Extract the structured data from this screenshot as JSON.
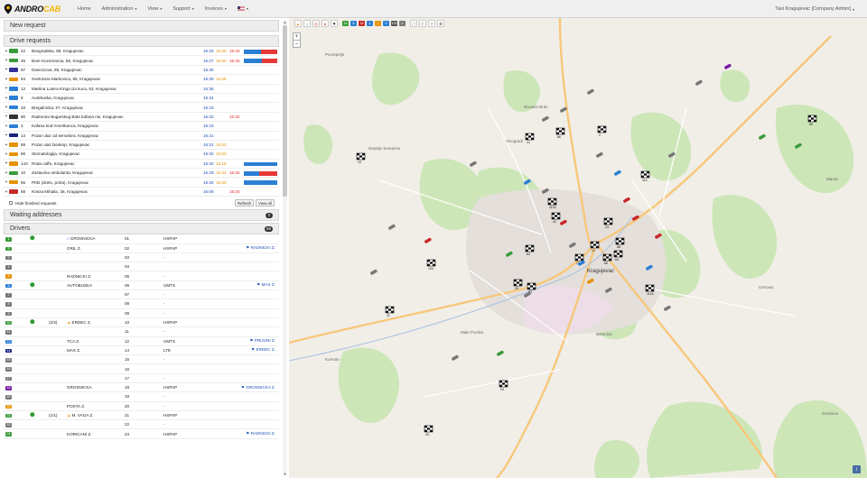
{
  "app": {
    "logo_part1": "ANDRO",
    "logo_part2": "CAB",
    "user": "Taxi Kragujevac [Company Admin]"
  },
  "nav": [
    {
      "label": "Home",
      "caret": false
    },
    {
      "label": "Administration",
      "caret": true
    },
    {
      "label": "View",
      "caret": true
    },
    {
      "label": "Support",
      "caret": true
    },
    {
      "label": "Invoices",
      "caret": true
    }
  ],
  "sections": {
    "new_request": "New request",
    "drive_requests": "Drive requests",
    "waiting_addresses": "Waiting addresses",
    "waiting_count": "0",
    "drivers": "Drivers",
    "drivers_count": "86"
  },
  "requests": [
    {
      "badge_color": "#3a9a3a",
      "num": "42",
      "addr": "Beogradska, 96, Kragujevac",
      "t1": "16:25",
      "t2": "16:30",
      "t3": "16:36",
      "bar": [
        0.5,
        0.5
      ]
    },
    {
      "badge_color": "#3a9a3a",
      "num": "45",
      "addr": "Bore Kozomarcia, 58, Kragujevac",
      "t1": "16:27",
      "t2": "16:30",
      "t3": "16:36",
      "bar": [
        0.55,
        0.45
      ]
    },
    {
      "badge_color": "#333399",
      "num": "87",
      "addr": "Danicicova, 85, Kragujevac",
      "t1": "16:35",
      "t2": "",
      "t3": "",
      "bar": null
    },
    {
      "badge_color": "#e69100",
      "num": "64",
      "addr": "Svetozara Markovica, 85, Kragujevac",
      "t1": "16:28",
      "t2": "16:35",
      "t3": "",
      "bar": null
    },
    {
      "badge_color": "#2a7fd4",
      "num": "12",
      "addr": "Martina Lutera Kinga iza kuca, 53, Kragujevac",
      "t1": "16:36",
      "t2": "",
      "t3": "",
      "bar": null
    },
    {
      "badge_color": "#2a7fd4",
      "num": "8",
      "addr": "Autobuska, Kragujevac",
      "t1": "16:34",
      "t2": "",
      "t3": "",
      "bar": null
    },
    {
      "badge_color": "#2a7fd4",
      "num": "33",
      "addr": "Bregalnicka, 57, Kragujevac",
      "t1": "16:33",
      "t2": "",
      "t3": "",
      "bar": null
    },
    {
      "badge_color": "#333",
      "num": "80",
      "addr": "Radomira Bugarskog Bate kafana nis, Kragujevac",
      "t1": "16:32",
      "t2": "",
      "t3": "16:32",
      "bar": null
    },
    {
      "badge_color": "#2a7fd4",
      "num": "2",
      "addr": "Kafana kod Amerikanca, Kragujevac",
      "t1": "16:33",
      "t2": "",
      "t3": "",
      "bar": null
    },
    {
      "badge_color": "#1a237e",
      "num": "14",
      "addr": "Pozar ulaz od semafora, Kragujevac",
      "t1": "16:31",
      "t2": "",
      "t3": "",
      "bar": null
    },
    {
      "badge_color": "#e69100",
      "num": "69",
      "addr": "Pozar ulaz bioskop, Kragujevac",
      "t1": "16:31",
      "t2": "16:33",
      "t3": "",
      "bar": null
    },
    {
      "badge_color": "#e69100",
      "num": "86",
      "addr": "Stomatologija, Kragujevac",
      "t1": "16:30",
      "t2": "16:33",
      "t3": "",
      "bar": null
    },
    {
      "badge_color": "#e69100",
      "num": "143",
      "addr": "Roda caffe, Kragujevac",
      "t1": "16:30",
      "t2": "16:18",
      "t3": "",
      "bar": [
        1.0,
        0.0
      ]
    },
    {
      "badge_color": "#3a9a3a",
      "num": "10",
      "addr": "Zastavina ambulanta, Kragujevac",
      "t1": "16:29",
      "t2": "16:32",
      "t3": "16:35",
      "bar": [
        0.45,
        0.55
      ]
    },
    {
      "badge_color": "#e69100",
      "num": "65",
      "addr": "PKB (dzelo, porta), Kragujevac",
      "t1": "16:28",
      "t2": "16:30",
      "t3": "",
      "bar": [
        1.0,
        0.0
      ]
    },
    {
      "badge_color": "#c62828",
      "num": "88",
      "addr": "Kneza Mihaila, 38, Kragujevac",
      "t1": "16:08",
      "t2": "",
      "t3": "16:26",
      "bar": null
    }
  ],
  "req_footer": {
    "hide_label": "Hide finished requests",
    "refresh": "Refresh",
    "view_all": "View all"
  },
  "drivers": [
    {
      "nb": "1",
      "color": "#3a9a3a",
      "pin": true,
      "note": "",
      "loc": "GROSNICKA",
      "loc_icon": "house",
      "vn": "01",
      "net": "HSPAP",
      "dest": ""
    },
    {
      "nb": "2",
      "color": "#3a9a3a",
      "pin": false,
      "note": "",
      "loc": "GRIL Z.",
      "loc_icon": "",
      "vn": "02",
      "net": "HSPAP",
      "dest": "RADNICKI Z."
    },
    {
      "nb": "3",
      "color": "#777",
      "pin": false,
      "note": "",
      "loc": "",
      "loc_icon": "",
      "vn": "03",
      "net": "-",
      "dest": ""
    },
    {
      "nb": "4",
      "color": "#777",
      "pin": false,
      "note": "",
      "loc": "",
      "loc_icon": "",
      "vn": "04",
      "net": "",
      "dest": ""
    },
    {
      "nb": "5",
      "color": "#e69100",
      "pin": false,
      "note": "",
      "loc": "RADNICKI Z.",
      "loc_icon": "",
      "vn": "05",
      "net": "-",
      "dest": ""
    },
    {
      "nb": "6",
      "color": "#2a7fd4",
      "pin": true,
      "note": "",
      "loc": "AUTOBUSKA",
      "loc_icon": "",
      "vn": "06",
      "net": "UMTS",
      "dest": "MAX Z."
    },
    {
      "nb": "7",
      "color": "#777",
      "pin": false,
      "note": "",
      "loc": "",
      "loc_icon": "",
      "vn": "07",
      "net": "-",
      "dest": ""
    },
    {
      "nb": "8",
      "color": "#777",
      "pin": false,
      "note": "",
      "loc": "",
      "loc_icon": "",
      "vn": "08",
      "net": "-",
      "dest": ""
    },
    {
      "nb": "9",
      "color": "#777",
      "pin": false,
      "note": "",
      "loc": "",
      "loc_icon": "",
      "vn": "09",
      "net": "-",
      "dest": ""
    },
    {
      "nb": "10",
      "color": "#3a9a3a",
      "pin": true,
      "note": "(2/2)",
      "loc": "ERDEC Z.",
      "loc_icon": "warn",
      "vn": "10",
      "net": "HSPAP",
      "dest": ""
    },
    {
      "nb": "11",
      "color": "#777",
      "pin": false,
      "note": "",
      "loc": "",
      "loc_icon": "",
      "vn": "11",
      "net": "-",
      "dest": ""
    },
    {
      "nb": "12",
      "color": "#2a7fd4",
      "pin": false,
      "note": "",
      "loc": "TCA Z.",
      "loc_icon": "",
      "vn": "12",
      "net": "UMTS",
      "dest": "PRIJUNI Z."
    },
    {
      "nb": "14",
      "color": "#1a237e",
      "pin": false,
      "note": "",
      "loc": "MAX Z.",
      "loc_icon": "",
      "vn": "14",
      "net": "LTE",
      "dest": "ERDEC Z."
    },
    {
      "nb": "15",
      "color": "#777",
      "pin": false,
      "note": "",
      "loc": "",
      "loc_icon": "",
      "vn": "15",
      "net": "-",
      "dest": ""
    },
    {
      "nb": "16",
      "color": "#777",
      "pin": false,
      "note": "",
      "loc": "",
      "loc_icon": "",
      "vn": "16",
      "net": "",
      "dest": ""
    },
    {
      "nb": "17",
      "color": "#777",
      "pin": false,
      "note": "",
      "loc": "",
      "loc_icon": "",
      "vn": "17",
      "net": "-",
      "dest": ""
    },
    {
      "nb": "18",
      "color": "#7b1fa2",
      "pin": false,
      "note": "",
      "loc": "GROSNICKA",
      "loc_icon": "",
      "vn": "18",
      "net": "HSPAP",
      "dest": "GROSNICKA Z."
    },
    {
      "nb": "19",
      "color": "#777",
      "pin": false,
      "note": "",
      "loc": "",
      "loc_icon": "",
      "vn": "19",
      "net": "-",
      "dest": ""
    },
    {
      "nb": "20",
      "color": "#e69100",
      "pin": false,
      "note": "",
      "loc": "POSTA Z.",
      "loc_icon": "",
      "vn": "20",
      "net": "-",
      "dest": ""
    },
    {
      "nb": "21",
      "color": "#3a9a3a",
      "pin": true,
      "note": "(1/1)",
      "loc": "M. VAGA Z.",
      "loc_icon": "warn",
      "vn": "21",
      "net": "HSPAP",
      "dest": ""
    },
    {
      "nb": "22",
      "color": "#777",
      "pin": false,
      "note": "",
      "loc": "",
      "loc_icon": "",
      "vn": "22",
      "net": "-",
      "dest": ""
    },
    {
      "nb": "24",
      "color": "#3a9a3a",
      "pin": false,
      "note": "",
      "loc": "KORICANI Z.",
      "loc_icon": "",
      "vn": "24",
      "net": "HSPAP",
      "dest": "RADNICKI Z."
    }
  ],
  "map_toolbar": [
    {
      "label": "16",
      "color": "#3a9a3a"
    },
    {
      "label": "8",
      "color": "#2a7fd4"
    },
    {
      "label": "16",
      "color": "#c62828"
    },
    {
      "label": "4",
      "color": "#2a7fd4"
    },
    {
      "label": "2",
      "color": "#e69100"
    },
    {
      "label": "0",
      "color": "#2a7fd4"
    },
    {
      "label": "105",
      "color": "#555"
    },
    {
      "label": "4",
      "color": "#777"
    }
  ],
  "map_labels": [
    "Pocrepelje",
    "Divostin Brdo",
    "Vinogradi",
    "Naselje Sumarice",
    "Male Pcelice",
    "Kragujevac",
    "Bresnica",
    "Marsic",
    "Korman",
    "Cerovac",
    "Grosnica"
  ],
  "map_markers": [
    "86",
    "21",
    "2",
    "10",
    "114",
    "80",
    "1103",
    "104",
    "24",
    "64",
    "39",
    "63",
    "65",
    "42",
    "14",
    "1143",
    "11",
    "24",
    "43",
    "18",
    "68",
    "84"
  ]
}
